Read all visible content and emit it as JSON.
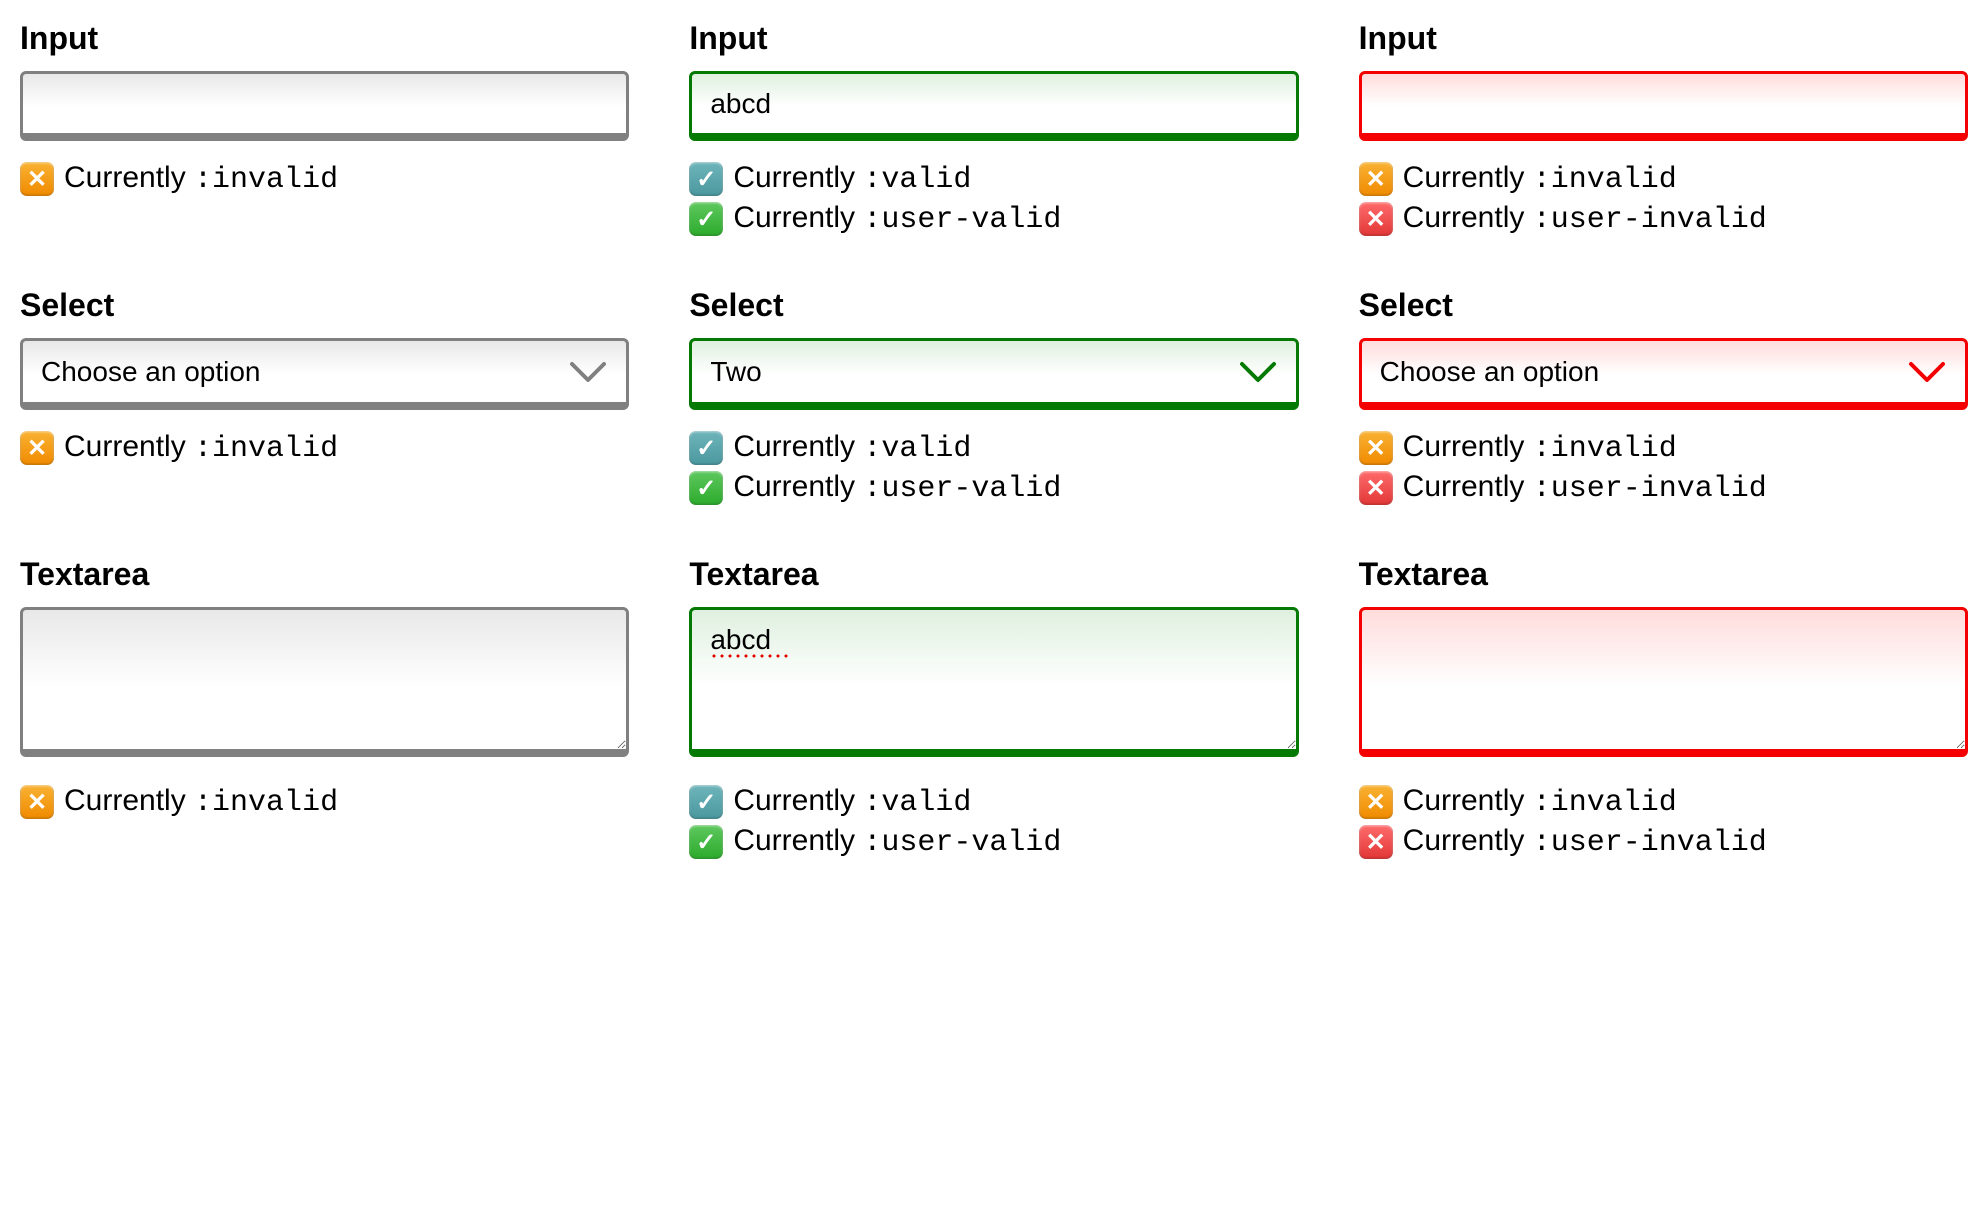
{
  "labels": {
    "input": "Input",
    "select": "Select",
    "textarea": "Textarea"
  },
  "status": {
    "currently_prefix": "Currently ",
    "invalid": ":invalid",
    "valid": ":valid",
    "user_valid": ":user-valid",
    "user_invalid": ":user-invalid"
  },
  "select": {
    "placeholder": "Choose an option",
    "col2_value": "Two"
  },
  "input": {
    "col2_value": "abcd"
  },
  "textarea": {
    "col2_value": "abcd"
  }
}
